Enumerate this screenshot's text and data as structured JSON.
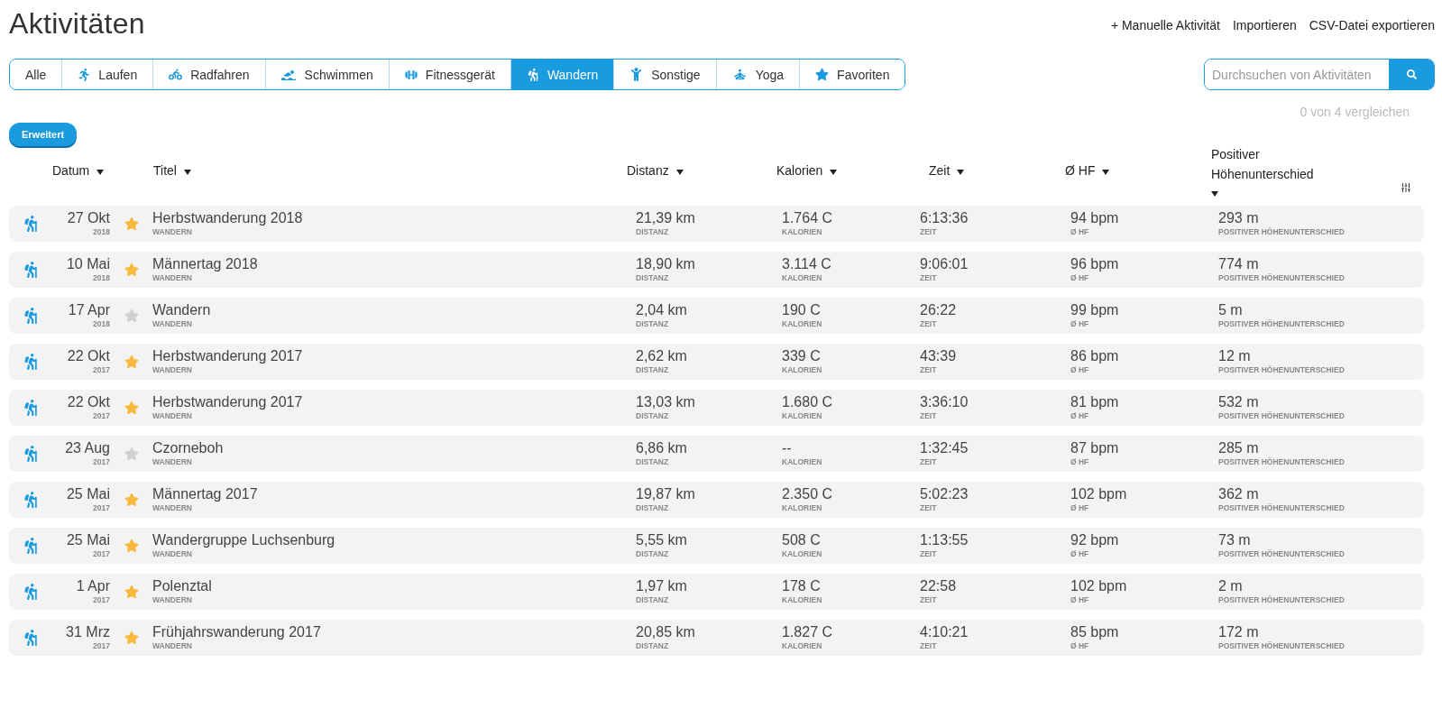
{
  "page_title": "Aktivitäten",
  "header_links": [
    "+ Manuelle Aktivität",
    "Importieren",
    "CSV-Datei exportieren"
  ],
  "tabs": [
    {
      "label": "Alle",
      "kind": "all",
      "selected": false
    },
    {
      "label": "Laufen",
      "kind": "running",
      "selected": false
    },
    {
      "label": "Radfahren",
      "kind": "cycling",
      "selected": false
    },
    {
      "label": "Schwimmen",
      "kind": "swimming",
      "selected": false
    },
    {
      "label": "Fitnessgerät",
      "kind": "fitness",
      "selected": false
    },
    {
      "label": "Wandern",
      "kind": "hiking",
      "selected": true
    },
    {
      "label": "Sonstige",
      "kind": "other",
      "selected": false
    },
    {
      "label": "Yoga",
      "kind": "yoga",
      "selected": false
    },
    {
      "label": "Favoriten",
      "kind": "favorites",
      "selected": false
    }
  ],
  "search": {
    "placeholder": "Durchsuchen von Aktivitäten"
  },
  "compare": "0 von 4 vergleichen",
  "advanced_button": "Erweitert",
  "columns": [
    "Datum",
    "Titel",
    "Distanz",
    "Kalorien",
    "Zeit",
    "Ø HF",
    "Positiver Höhenunterschied"
  ],
  "rows": [
    {
      "date": "27 Okt",
      "year": "2018",
      "starred": true,
      "title": "Herbstwanderung 2018",
      "type": "WANDERN",
      "values": [
        [
          "21,39 km",
          "DISTANZ"
        ],
        [
          "1.764 C",
          "KALORIEN"
        ],
        [
          "6:13:36",
          "ZEIT"
        ],
        [
          "94 bpm",
          "Ø HF"
        ],
        [
          "293 m",
          "POSITIVER HÖHENUNTERSCHIED"
        ]
      ]
    },
    {
      "date": "10 Mai",
      "year": "2018",
      "starred": true,
      "title": "Männertag 2018",
      "type": "WANDERN",
      "values": [
        [
          "18,90 km",
          "DISTANZ"
        ],
        [
          "3.114 C",
          "KALORIEN"
        ],
        [
          "9:06:01",
          "ZEIT"
        ],
        [
          "96 bpm",
          "Ø HF"
        ],
        [
          "774 m",
          "POSITIVER HÖHENUNTERSCHIED"
        ]
      ]
    },
    {
      "date": "17 Apr",
      "year": "2018",
      "starred": false,
      "title": "Wandern",
      "type": "WANDERN",
      "values": [
        [
          "2,04 km",
          "DISTANZ"
        ],
        [
          "190 C",
          "KALORIEN"
        ],
        [
          "26:22",
          "ZEIT"
        ],
        [
          "99 bpm",
          "Ø HF"
        ],
        [
          "5 m",
          "POSITIVER HÖHENUNTERSCHIED"
        ]
      ]
    },
    {
      "date": "22 Okt",
      "year": "2017",
      "starred": true,
      "title": "Herbstwanderung 2017",
      "type": "WANDERN",
      "values": [
        [
          "2,62 km",
          "DISTANZ"
        ],
        [
          "339 C",
          "KALORIEN"
        ],
        [
          "43:39",
          "ZEIT"
        ],
        [
          "86 bpm",
          "Ø HF"
        ],
        [
          "12 m",
          "POSITIVER HÖHENUNTERSCHIED"
        ]
      ]
    },
    {
      "date": "22 Okt",
      "year": "2017",
      "starred": true,
      "title": "Herbstwanderung 2017",
      "type": "WANDERN",
      "values": [
        [
          "13,03 km",
          "DISTANZ"
        ],
        [
          "1.680 C",
          "KALORIEN"
        ],
        [
          "3:36:10",
          "ZEIT"
        ],
        [
          "81 bpm",
          "Ø HF"
        ],
        [
          "532 m",
          "POSITIVER HÖHENUNTERSCHIED"
        ]
      ]
    },
    {
      "date": "23 Aug",
      "year": "2017",
      "starred": false,
      "title": "Czorneboh",
      "type": "WANDERN",
      "values": [
        [
          "6,86 km",
          "DISTANZ"
        ],
        [
          "--",
          "KALORIEN"
        ],
        [
          "1:32:45",
          "ZEIT"
        ],
        [
          "87 bpm",
          "Ø HF"
        ],
        [
          "285 m",
          "POSITIVER HÖHENUNTERSCHIED"
        ]
      ]
    },
    {
      "date": "25 Mai",
      "year": "2017",
      "starred": true,
      "title": "Männertag 2017",
      "type": "WANDERN",
      "values": [
        [
          "19,87 km",
          "DISTANZ"
        ],
        [
          "2.350 C",
          "KALORIEN"
        ],
        [
          "5:02:23",
          "ZEIT"
        ],
        [
          "102 bpm",
          "Ø HF"
        ],
        [
          "362 m",
          "POSITIVER HÖHENUNTERSCHIED"
        ]
      ]
    },
    {
      "date": "25 Mai",
      "year": "2017",
      "starred": true,
      "title": "Wandergruppe Luchsenburg",
      "type": "WANDERN",
      "values": [
        [
          "5,55 km",
          "DISTANZ"
        ],
        [
          "508 C",
          "KALORIEN"
        ],
        [
          "1:13:55",
          "ZEIT"
        ],
        [
          "92 bpm",
          "Ø HF"
        ],
        [
          "73 m",
          "POSITIVER HÖHENUNTERSCHIED"
        ]
      ]
    },
    {
      "date": "1 Apr",
      "year": "2017",
      "starred": true,
      "title": "Polenztal",
      "type": "WANDERN",
      "values": [
        [
          "1,97 km",
          "DISTANZ"
        ],
        [
          "178 C",
          "KALORIEN"
        ],
        [
          "22:58",
          "ZEIT"
        ],
        [
          "102 bpm",
          "Ø HF"
        ],
        [
          "2 m",
          "POSITIVER HÖHENUNTERSCHIED"
        ]
      ]
    },
    {
      "date": "31 Mrz",
      "year": "2017",
      "starred": true,
      "title": "Frühjahrswanderung 2017",
      "type": "WANDERN",
      "values": [
        [
          "20,85 km",
          "DISTANZ"
        ],
        [
          "1.827 C",
          "KALORIEN"
        ],
        [
          "4:10:21",
          "ZEIT"
        ],
        [
          "85 bpm",
          "Ø HF"
        ],
        [
          "172 m",
          "POSITIVER HÖHENUNTERSCHIED"
        ]
      ]
    }
  ]
}
